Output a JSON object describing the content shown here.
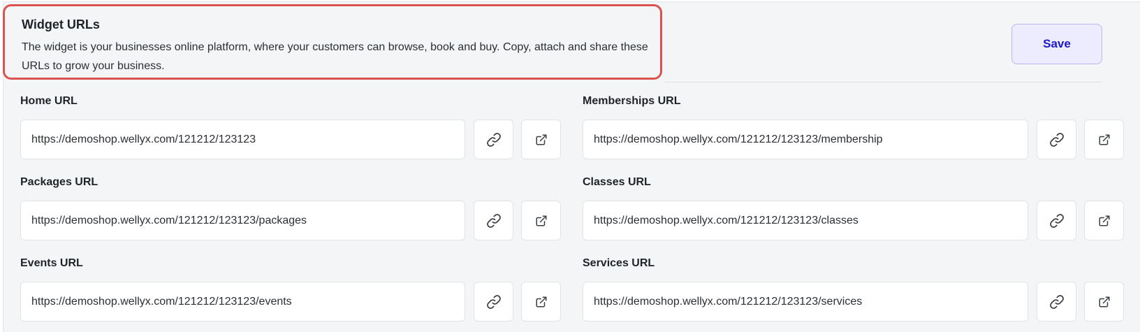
{
  "header": {
    "title": "Widget URLs",
    "description": "The widget is your businesses online platform, where your customers can browse, book and buy. Copy, attach and share these URLs to grow your business."
  },
  "toolbar": {
    "save_label": "Save"
  },
  "fields": {
    "home": {
      "label": "Home URL",
      "value": "https://demoshop.wellyx.com/121212/123123"
    },
    "memberships": {
      "label": "Memberships URL",
      "value": "https://demoshop.wellyx.com/121212/123123/membership"
    },
    "packages": {
      "label": "Packages URL",
      "value": "https://demoshop.wellyx.com/121212/123123/packages"
    },
    "classes": {
      "label": "Classes URL",
      "value": "https://demoshop.wellyx.com/121212/123123/classes"
    },
    "events": {
      "label": "Events URL",
      "value": "https://demoshop.wellyx.com/121212/123123/events"
    },
    "services": {
      "label": "Services URL",
      "value": "https://demoshop.wellyx.com/121212/123123/services"
    }
  },
  "icons": {
    "copy": "link-icon",
    "open": "external-link-icon"
  },
  "colors": {
    "accent": "#1b18c9",
    "save_bg": "#ececfe",
    "highlight_border": "#d9534f",
    "panel_bg": "#f4f5f7"
  }
}
